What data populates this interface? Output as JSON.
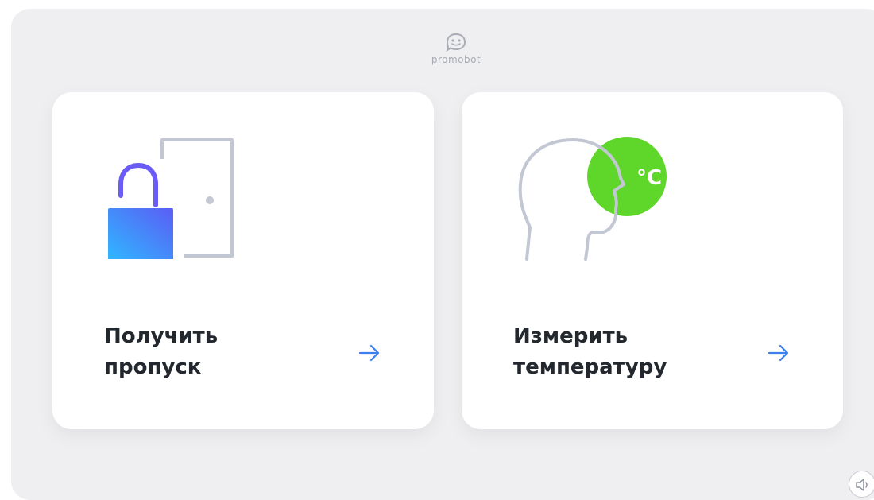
{
  "brand": {
    "name": "promobot",
    "logo_icon": "smiley-robot-face-icon"
  },
  "cards": [
    {
      "id": "get-pass",
      "title": "Получить\nпропуск",
      "icon": "unlocked-padlock-door-icon",
      "action_icon": "arrow-right-icon"
    },
    {
      "id": "measure-temperature",
      "title": "Измерить\nтемпературу",
      "icon": "head-temperature-icon",
      "badge": "°C",
      "action_icon": "arrow-right-icon"
    }
  ],
  "sound_button": {
    "icon": "speaker-icon"
  },
  "colors": {
    "background": "#efeff1",
    "card": "#ffffff",
    "text": "#23272e",
    "accent_arrow": "#3d7ef0",
    "lock_gradient_start": "#2fb8ff",
    "lock_gradient_end": "#5b5df5",
    "lock_shackle": "#6b5cf6",
    "temperature_badge": "#5fd62a",
    "outline_gray": "#c3c7d3"
  }
}
